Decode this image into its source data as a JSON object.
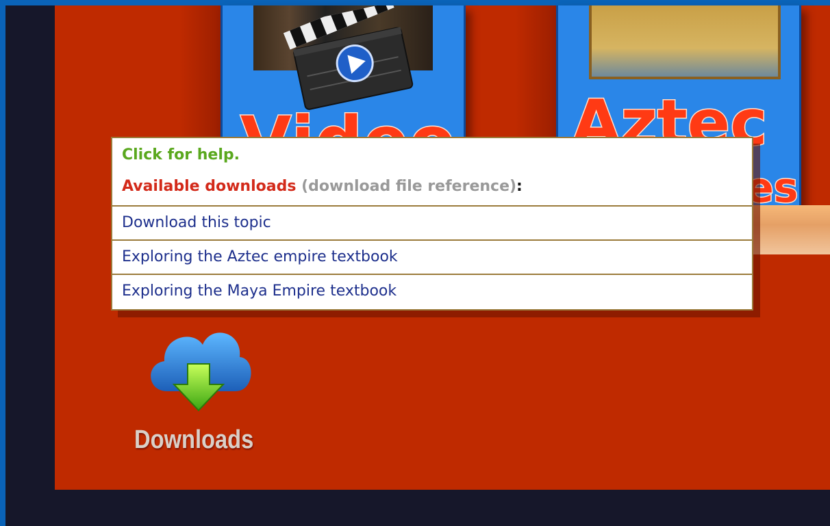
{
  "tiles": {
    "video": {
      "label": "Video"
    },
    "aztec": {
      "label": "Aztec",
      "label2": "es"
    }
  },
  "popup": {
    "help": "Click for help.",
    "available_title": "Available downloads",
    "available_ref": "(download file reference)",
    "available_colon": ":",
    "items": [
      {
        "label": "Download this topic"
      },
      {
        "label": "Exploring the Aztec empire textbook"
      },
      {
        "label": "Exploring the Maya Empire textbook"
      }
    ]
  },
  "downloads": {
    "label": "Downloads",
    "icon": "cloud-download-icon"
  },
  "colors": {
    "frame": "#0a63b8",
    "background": "#16172a",
    "panel": "#bf2a00",
    "help_text": "#5aa81e",
    "available_text": "#d32a1a",
    "link_text": "#1d2f8c"
  }
}
